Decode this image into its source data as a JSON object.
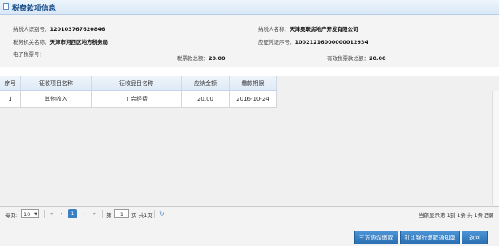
{
  "header": {
    "title": "税费款项信息"
  },
  "info": {
    "taxpayer_id_label": "纳税人识别号：",
    "taxpayer_id_value": "120103767620846",
    "taxpayer_name_label": "纳税人名称：",
    "taxpayer_name_value": "天津奥联房地产开发有限公司",
    "tax_office_label": "税务机关名称：",
    "tax_office_value": "天津市河西区地方税务局",
    "voucher_no_label": "应征凭证序号：",
    "voucher_no_value": "10021216000000012934",
    "e_ticket_label": "电子税票号：",
    "total_label": "税票款总额：",
    "total_value": "20.00",
    "valid_total_label": "有效税票款总额：",
    "valid_total_value": "20.00"
  },
  "table": {
    "columns": [
      "序号",
      "征收项目名称",
      "征收品目名称",
      "应纳金额",
      "缴款期限"
    ],
    "rows": [
      {
        "no": "1",
        "item": "其他收入",
        "subitem": "工会经费",
        "amount": "20.00",
        "deadline": "2016-10-24"
      }
    ]
  },
  "pager": {
    "per_page_label": "每页:",
    "per_page_value": "10",
    "first": "«",
    "prev": "‹",
    "current_page": "1",
    "next": "›",
    "last": "»",
    "page_prefix": "第",
    "page_input": "1",
    "page_suffix": "页 共1页",
    "summary": "当前显示第 1到 1条  共 1条记录"
  },
  "buttons": {
    "tripartite": "三方协议缴款",
    "print_notice": "打印银行缴款通知单",
    "back": "返回"
  },
  "colors": {
    "accent": "#2a6fb1",
    "header_bg": "#dfeaf6"
  }
}
